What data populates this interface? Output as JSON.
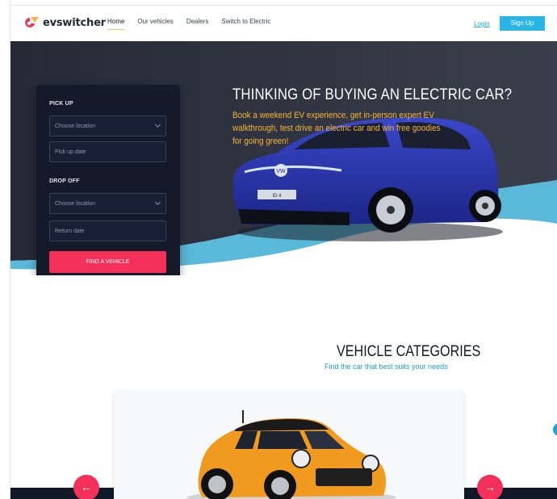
{
  "brand": {
    "name": "evswitcher"
  },
  "nav": {
    "items": [
      "Home",
      "Our vehicles",
      "Dealers",
      "Switch to Electric"
    ],
    "login": "Login",
    "signup": "Sign Up"
  },
  "booking": {
    "pickup_label": "PICK UP",
    "pickup_location": "Choose location",
    "pickup_date": "Pick up date",
    "dropoff_label": "DROP OFF",
    "dropoff_location": "Choose location",
    "return_date": "Return date",
    "find_button": "FIND A VEHICLE"
  },
  "hero": {
    "title": "THINKING OF BUYING AN ELECTRIC CAR?",
    "subtitle": "Book a weekend EV experience, get in-person expert EV walkthrough, test drive an electric car and win free goodies for going green!",
    "plate": "ID.4"
  },
  "categories": {
    "title": "VEHICLE CATEGORIES",
    "subtitle": "Find the car that best suits your needs",
    "prev_icon": "arrow-left-icon",
    "next_icon": "arrow-right-icon"
  },
  "colors": {
    "accent": "#f2305a",
    "brand_blue": "#29b6e6",
    "hero_dark": "#2c3140",
    "wave": "#5ab8d8",
    "headline_orange": "#f6b53c"
  }
}
